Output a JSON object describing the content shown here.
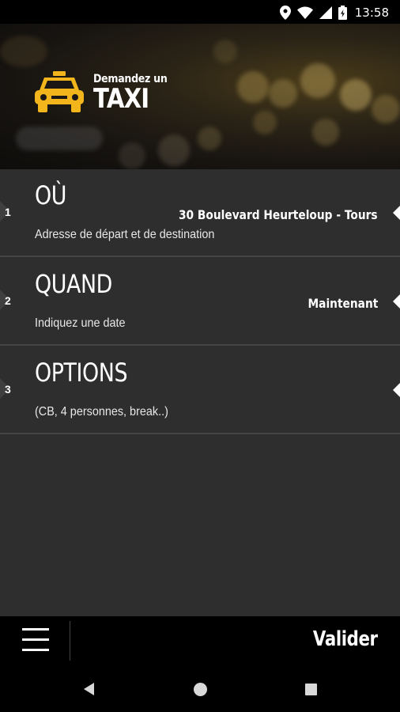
{
  "status_bar": {
    "time": "13:58",
    "icons": [
      "location-icon",
      "wifi-icon",
      "signal-icon",
      "battery-icon"
    ]
  },
  "header": {
    "logo_small_text": "Demandez un",
    "logo_big_text": "TAXI",
    "accent_color": "#f2b51b"
  },
  "rows": [
    {
      "number": "1",
      "title": "OÙ",
      "subtitle": "Adresse de départ et de destination",
      "value": "30  Boulevard Heurteloup - Tours"
    },
    {
      "number": "2",
      "title": "QUAND",
      "subtitle": "Indiquez une date",
      "value": "Maintenant"
    },
    {
      "number": "3",
      "title": "OPTIONS",
      "subtitle": "(CB, 4 personnes, break..)",
      "value": ""
    }
  ],
  "toolbar": {
    "menu_icon": "hamburger-menu-icon",
    "validate_label": "Valider"
  },
  "navbar": {
    "icons": [
      "back-icon",
      "home-icon",
      "recent-apps-icon"
    ]
  }
}
